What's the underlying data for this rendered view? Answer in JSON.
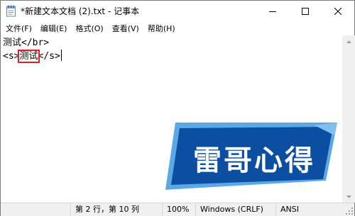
{
  "window": {
    "title": "*新建文本文档 (2).txt - 记事本"
  },
  "menu": {
    "items": [
      {
        "label": "文件(F)"
      },
      {
        "label": "编辑(E)"
      },
      {
        "label": "格式(O)"
      },
      {
        "label": "查看(V)"
      },
      {
        "label": "帮助(H)"
      }
    ]
  },
  "editor": {
    "line1": "测试</br>",
    "line2_before": "<s>",
    "line2_highlight": "测试",
    "line2_after": "</s>"
  },
  "status": {
    "position": "第 2 行，第 10 列",
    "zoom": "100%",
    "line_ending": "Windows (CRLF)",
    "encoding": "ANSI"
  },
  "watermark": {
    "text": "雷哥心得",
    "colors": {
      "primary": "#0b4ea2",
      "light": "#5aa9e6",
      "text": "#ffffff"
    }
  },
  "icons": {
    "app": "notepad-icon",
    "minimize": "minimize-icon",
    "maximize": "maximize-icon",
    "close": "close-icon"
  }
}
